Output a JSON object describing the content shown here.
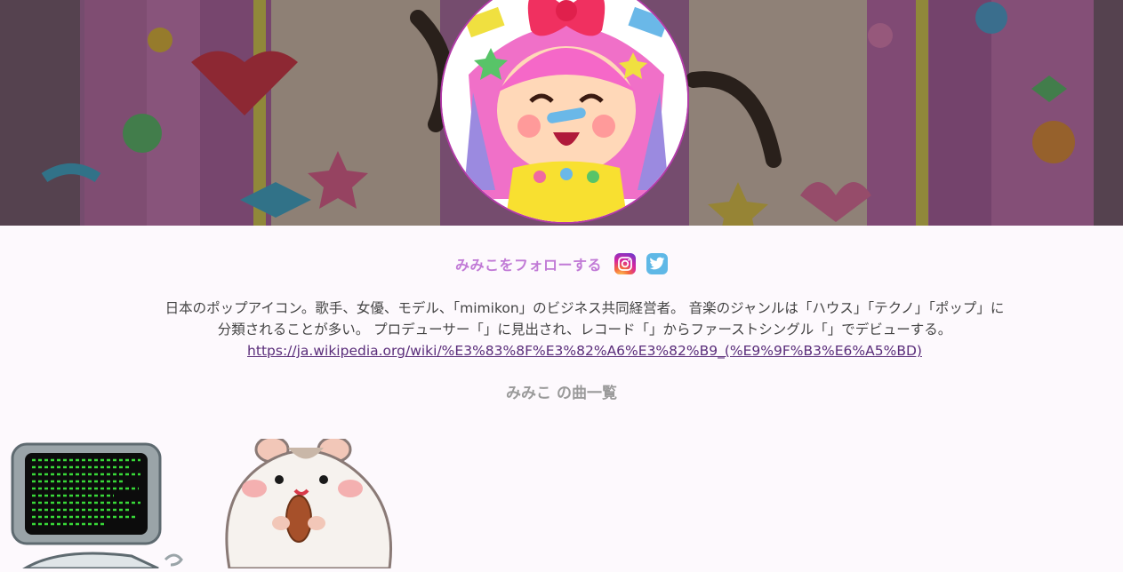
{
  "banner": {
    "image": "decorated-pop-background",
    "avatar": "mimiko-character-avatar"
  },
  "follow": {
    "label": "みみこをフォローする",
    "icons": [
      "instagram-icon",
      "twitter-icon"
    ]
  },
  "description": {
    "text": "日本のポップアイコン。歌手、女優、モデル、「mimikon」のビジネス共同経営者。 音楽のジャンルは「ハウス」「テクノ」「ポップ」に分類されることが多い。 プロデューサー「」に見出され、レコード「」からファーストシングル「」でデビューする。",
    "link": "https://ja.wikipedia.org/wiki/%E3%83%8F%E3%82%A6%E3%82%B9_(%E9%9F%B3%E6%A5%BD)"
  },
  "songs": {
    "title": "みみこ の曲一覧",
    "items": [
      {
        "thumbnail": "computer-terminal-illustration"
      },
      {
        "thumbnail": "hamster-eating-illustration"
      }
    ]
  },
  "colors": {
    "accent": "#c17ad6",
    "avatar_ring": "#b23aa8",
    "link": "#5a2d7a",
    "background": "#fdf9fd"
  }
}
